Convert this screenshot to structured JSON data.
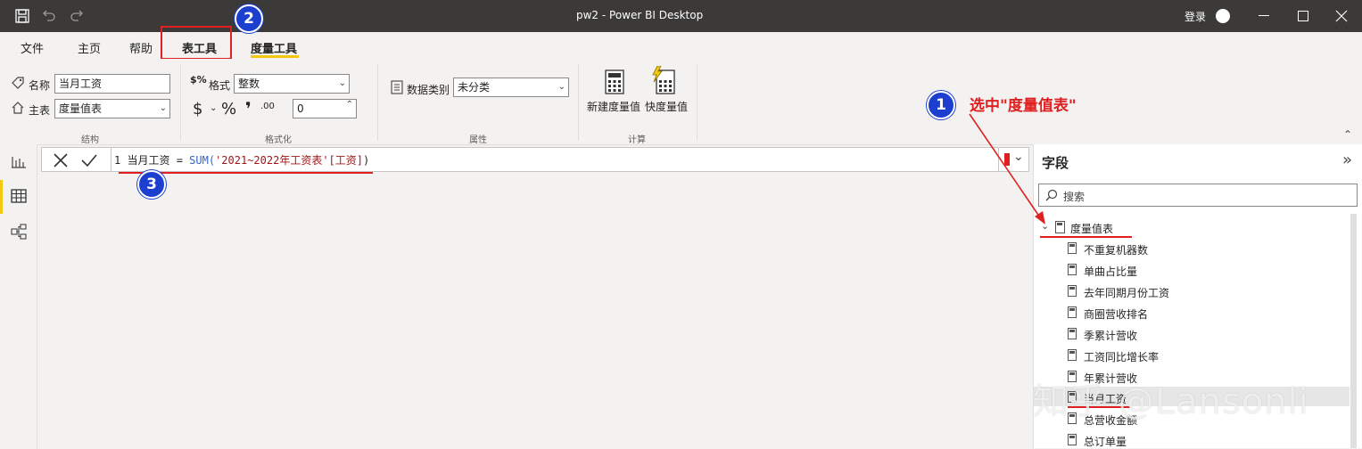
{
  "window": {
    "title": "pw2 - Power BI Desktop",
    "signin": "登录"
  },
  "tabs": [
    {
      "label": "文件"
    },
    {
      "label": "主页"
    },
    {
      "label": "帮助"
    },
    {
      "label": "表工具"
    },
    {
      "label": "度量工具"
    }
  ],
  "ribbon": {
    "structure": {
      "name_label": "名称",
      "name_value": "当月工资",
      "home_table_label": "主表",
      "home_table_value": "度量值表",
      "group_label": "结构"
    },
    "formatting": {
      "format_label": "格式",
      "format_value": "整数",
      "currency_symbol": "$",
      "percent_symbol": "%",
      "comma_symbol": "❜",
      "decimal_symbol": ".00",
      "decimals_value": "0",
      "group_label": "格式化"
    },
    "properties": {
      "data_category_label": "数据类别",
      "data_category_value": "未分类",
      "group_label": "属性"
    },
    "calculations": {
      "new_measure": "新建度量值",
      "quick_measure": "快度量值",
      "group_label": "计算"
    }
  },
  "formula": {
    "line_number": "1",
    "name": "当月工资",
    "equals": " = ",
    "func": "SUM(",
    "arg": "'2021~2022年工资表'[工资]",
    "close": ")"
  },
  "fields_pane": {
    "title": "字段",
    "search_placeholder": "搜索",
    "table_name": "度量值表",
    "fields": [
      "不重复机器数",
      "单曲占比量",
      "去年同期月份工资",
      "商圈营收排名",
      "季累计营收",
      "工资同比增长率",
      "年累计营收",
      "当月工资",
      "总营收金额",
      "总订单量"
    ]
  },
  "annotations": {
    "step1": "1",
    "step2": "2",
    "step3": "3",
    "step1_text": "选中\"度量值表\""
  },
  "watermark": "知乎 @Lansonli",
  "colors": {
    "title_bar": "#3b3a39",
    "accent_yellow": "#f2c811",
    "annotation_red": "#e02020",
    "annotation_blue": "#1c3fd0",
    "dax_function": "#3165c6",
    "dax_string": "#a31515"
  }
}
